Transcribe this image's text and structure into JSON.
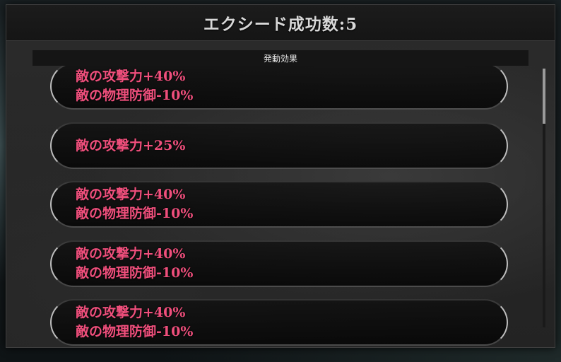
{
  "header": {
    "title": "エクシード成功数:5"
  },
  "section": {
    "label": "発動効果"
  },
  "effects": [
    {
      "lines": [
        "敵の攻撃力+40%",
        "敵の物理防御-10%"
      ]
    },
    {
      "lines": [
        "敵の攻撃力+25%"
      ]
    },
    {
      "lines": [
        "敵の攻撃力+40%",
        "敵の物理防御-10%"
      ]
    },
    {
      "lines": [
        "敵の攻撃力+40%",
        "敵の物理防御-10%"
      ]
    },
    {
      "lines": [
        "敵の攻撃力+40%",
        "敵の物理防御-10%"
      ]
    }
  ],
  "colors": {
    "effect_text": "#ef4f7c",
    "title_text": "#d8d8d8"
  }
}
